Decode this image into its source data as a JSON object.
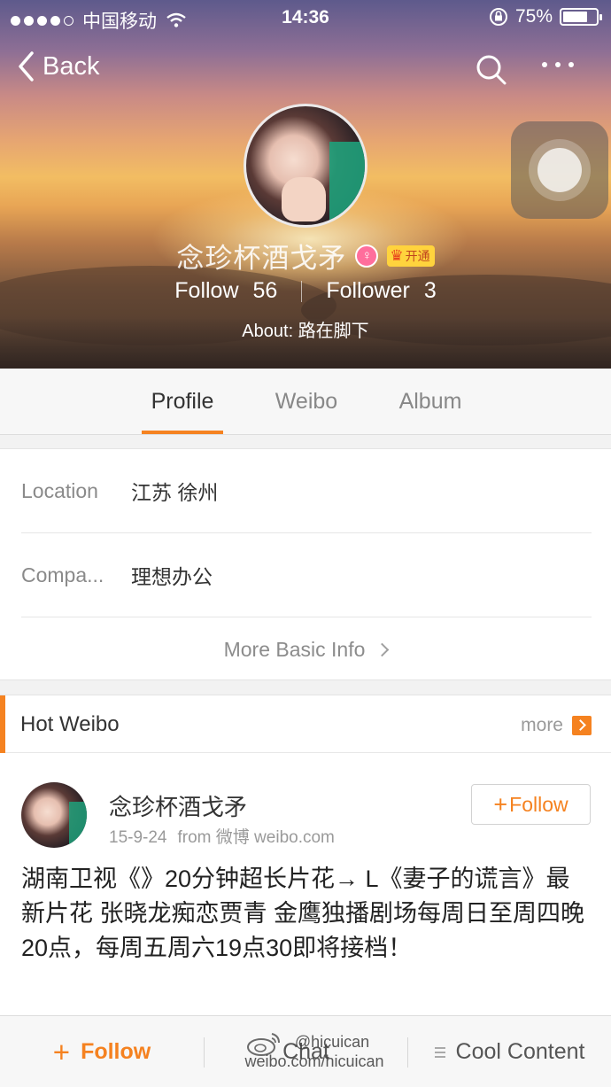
{
  "status_bar": {
    "carrier": "中国移动",
    "time": "14:36",
    "battery_percent": "75%",
    "battery_level": 0.75
  },
  "nav": {
    "back_label": "Back"
  },
  "profile": {
    "name": "念珍杯酒戈矛",
    "vip_label": "开通",
    "follow_label": "Follow",
    "follow_count": "56",
    "follower_label": "Follower",
    "follower_count": "3",
    "about": "About: 路在脚下"
  },
  "tabs": [
    {
      "label": "Profile",
      "active": true
    },
    {
      "label": "Weibo",
      "active": false
    },
    {
      "label": "Album",
      "active": false
    }
  ],
  "basic_info": {
    "rows": [
      {
        "label": "Location",
        "value": "江苏 徐州"
      },
      {
        "label": "Compa...",
        "value": "理想办公"
      }
    ],
    "more_label": "More Basic Info"
  },
  "hot_weibo": {
    "title": "Hot Weibo",
    "more_label": "more",
    "post": {
      "author": "念珍杯酒戈矛",
      "date": "15-9-24",
      "source": "from 微博 weibo.com",
      "follow_label": "Follow",
      "text": "湖南卫视《》20分钟超长片花→ L《妻子的谎言》最新片花 张晓龙痴恋贾青 金鹰独播剧场每周日至周四晚20点，每周五周六19点30即将接档！"
    }
  },
  "bottom_bar": {
    "follow_label": "Follow",
    "chat_label": "Chat",
    "cool_label": "Cool Content"
  },
  "watermark": {
    "user": "@hicuican",
    "url": "weibo.com/hicuican"
  },
  "colors": {
    "accent": "#f58220",
    "text_primary": "#333333",
    "text_secondary": "#8a8a8a"
  }
}
